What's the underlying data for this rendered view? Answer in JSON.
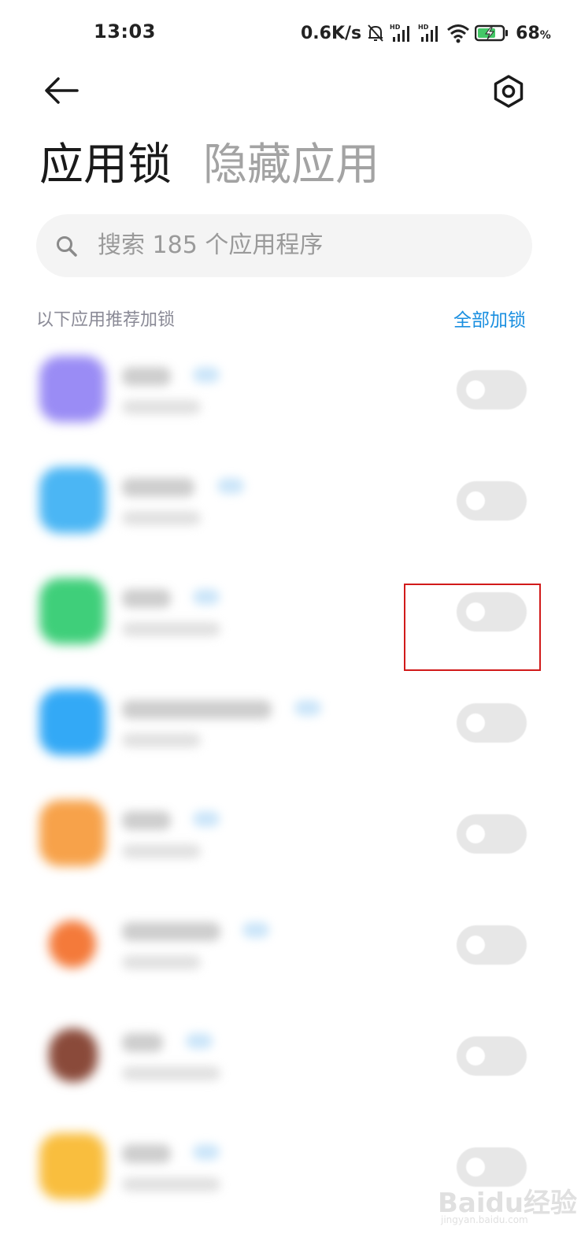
{
  "status_bar": {
    "time": "13:03",
    "network_speed": "0.6K/s",
    "battery_percent": "68",
    "battery_unit": "%",
    "icons": [
      "mute-bell-icon",
      "hd-signal-icon",
      "hd-signal-icon",
      "wifi-icon",
      "battery-charging-icon"
    ]
  },
  "header": {
    "back_icon": "back-arrow-icon",
    "settings_icon": "settings-hexagon-icon",
    "tab_active": "应用锁",
    "tab_inactive": "隐藏应用"
  },
  "search": {
    "icon": "search-icon",
    "placeholder": "搜索 185 个应用程序"
  },
  "section": {
    "label": "以下应用推荐加锁",
    "action": "全部加锁"
  },
  "apps": [
    {
      "icon_color": "#9a8cf5",
      "toggle_on": false
    },
    {
      "icon_color": "#4bb6f4",
      "toggle_on": false
    },
    {
      "icon_color": "#3fcf7a",
      "toggle_on": false
    },
    {
      "icon_color": "#33a9f6",
      "toggle_on": false
    },
    {
      "icon_color": "#f7a24a",
      "toggle_on": false
    },
    {
      "icon_color": "#f47a3a",
      "toggle_on": false
    },
    {
      "icon_color": "#8a4a3a",
      "toggle_on": false
    },
    {
      "icon_color": "#f9be3e",
      "toggle_on": false
    }
  ],
  "colors": {
    "accent": "#1a8fe0",
    "highlight_border": "#d11a1a"
  },
  "watermark": {
    "text": "Baidu经验",
    "sub": "jingyan.baidu.com"
  }
}
